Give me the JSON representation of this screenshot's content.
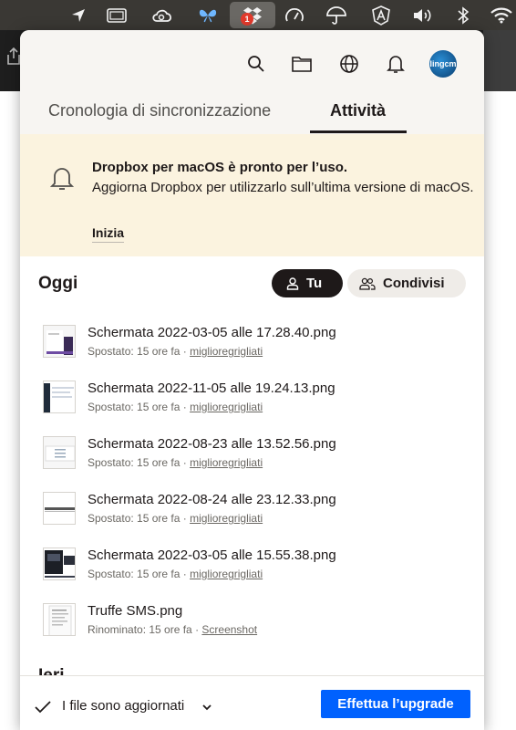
{
  "panel": {
    "tabs": [
      {
        "label": "Cronologia di sincronizzazione",
        "active": false
      },
      {
        "label": "Attività",
        "active": true
      }
    ],
    "avatar_text": "lingcm"
  },
  "notification": {
    "title": "Dropbox per macOS è pronto per l’uso.",
    "body": "Aggiorna Dropbox per utilizzarlo sull’ultima versione di macOS.",
    "link": "Inizia"
  },
  "section": {
    "today": "Oggi",
    "yesterday": "Ieri",
    "filters": [
      {
        "label": "Tu",
        "selected": true
      },
      {
        "label": "Condivisi",
        "selected": false
      }
    ]
  },
  "activity": [
    {
      "name": "Schermata 2022-03-05 alle 17.28.40.png",
      "action": "Spostato: 15 ore fa · ",
      "location": "miglioregrigliati"
    },
    {
      "name": "Schermata 2022-11-05 alle 19.24.13.png",
      "action": "Spostato: 15 ore fa · ",
      "location": "miglioregrigliati"
    },
    {
      "name": "Schermata 2022-08-23 alle 13.52.56.png",
      "action": "Spostato: 15 ore fa · ",
      "location": "miglioregrigliati"
    },
    {
      "name": "Schermata 2022-08-24 alle 23.12.33.png",
      "action": "Spostato: 15 ore fa · ",
      "location": "miglioregrigliati"
    },
    {
      "name": "Schermata 2022-03-05 alle 15.55.38.png",
      "action": "Spostato: 15 ore fa · ",
      "location": "miglioregrigliati"
    },
    {
      "name": "Truffe SMS.png",
      "action": "Rinominato: 15 ore fa · ",
      "location": "Screenshot"
    }
  ],
  "footer": {
    "status": "I file sono aggiornati",
    "upgrade_button": "Effettua l’upgrade"
  },
  "menubar": {
    "dropbox_badge": "1"
  },
  "colors": {
    "upgrade_blue": "#0061fe",
    "notice_bg": "#fbf3df",
    "badge_red": "#e23a2c"
  }
}
